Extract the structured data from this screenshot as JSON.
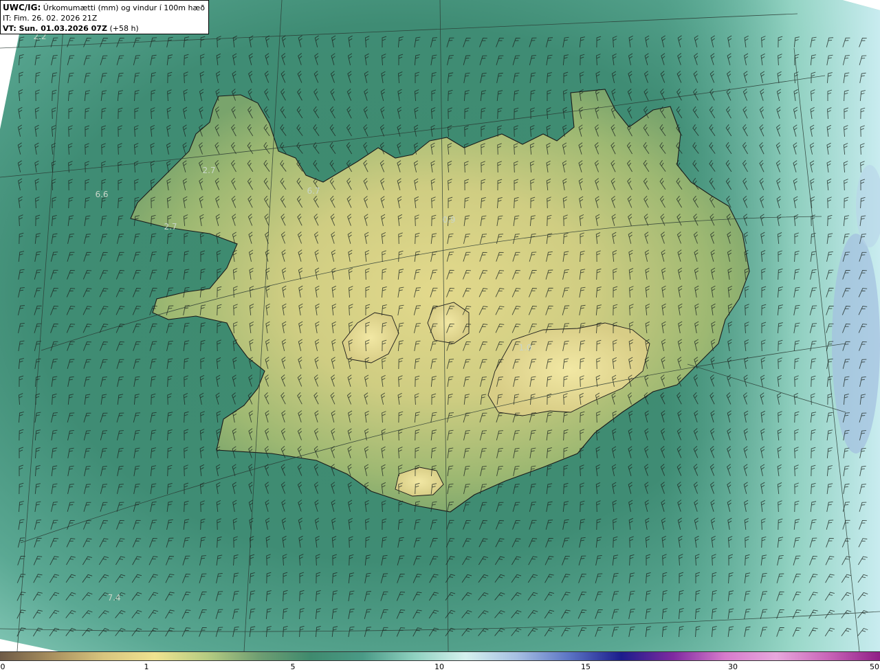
{
  "header": {
    "model": "UWC/IG:",
    "description": "Úrkomumætti (mm) og vindur í 100m hæð",
    "init_time": "IT: Fim. 26. 02. 2026 21Z",
    "valid_label": "VT: Sun. 01.03.2026 07Z",
    "lead": "(+58 h)"
  },
  "map_labels": [
    {
      "text": "2.2"
    },
    {
      "text": "6.6"
    },
    {
      "text": "2.7"
    },
    {
      "text": "2.7"
    },
    {
      "text": "6.7"
    },
    {
      "text": "0.9"
    },
    {
      "text": "1.0"
    },
    {
      "text": "7.4"
    }
  ],
  "colorbar": {
    "ticks": [
      "0",
      "1",
      "5",
      "10",
      "15",
      "30",
      "50"
    ],
    "colors": [
      "#6e5a46",
      "#a9905f",
      "#d8c57e",
      "#efe390",
      "#b6cc82",
      "#6f9e72",
      "#3f8a6e",
      "#4a9a86",
      "#8fd1c0",
      "#d5f1ee",
      "#a6bfe2",
      "#5b74c4",
      "#1b1d8c",
      "#7f2aa0",
      "#d77bcc",
      "#e8a7dc",
      "#c965b8",
      "#8f1f86"
    ]
  },
  "theme": {
    "ocean": "#3e8a74",
    "ocean_light": "#86cdb9",
    "land_low": "#94ad6c",
    "land_mid": "#c6c97f",
    "land_high": "#e9df92"
  }
}
